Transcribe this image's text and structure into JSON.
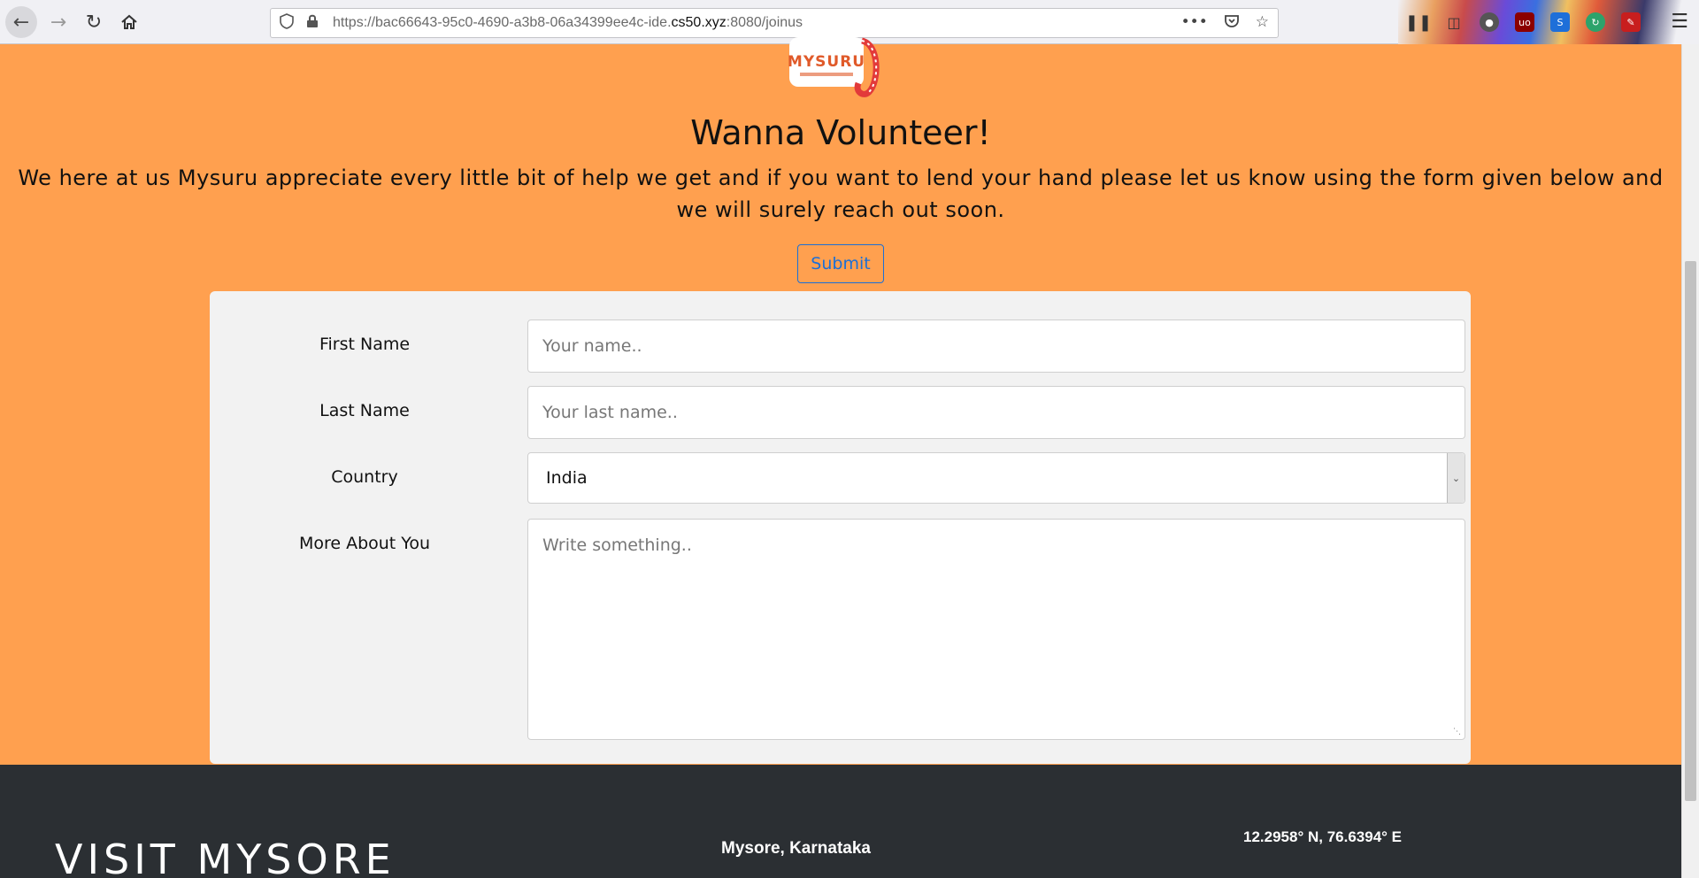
{
  "browser": {
    "url_prefix": "https://bac66643-95c0-4690-a3b8-06a34399ee4c-ide.",
    "url_domain": "cs50.xyz",
    "url_suffix": ":8080/joinus",
    "back_icon": "arrow-left-icon",
    "forward_icon": "arrow-right-icon",
    "reload_icon": "reload-icon",
    "home_icon": "home-icon"
  },
  "page": {
    "logo_text": "MYSURU",
    "heading": "Wanna Volunteer!",
    "intro": "We here at us Mysuru appreciate every little bit of help we get and if you want to lend your hand please let us know using the form given below and we will surely reach out soon.",
    "submit_label": "Submit"
  },
  "form": {
    "first_name_label": "First Name",
    "first_name_placeholder": "Your name..",
    "last_name_label": "Last Name",
    "last_name_placeholder": "Your last name..",
    "country_label": "Country",
    "country_value": "India",
    "about_label": "More About You",
    "about_placeholder": "Write something.."
  },
  "footer": {
    "brand": "VISIT MYSORE",
    "city": "Mysore, Karnataka",
    "coords": "12.2958° N, 76.6394° E"
  },
  "colors": {
    "page_bg": "#ffa04f",
    "footer_bg": "#2b2f33",
    "accent_blue": "#1a6fd8",
    "panel_bg": "#f2f2f2"
  }
}
